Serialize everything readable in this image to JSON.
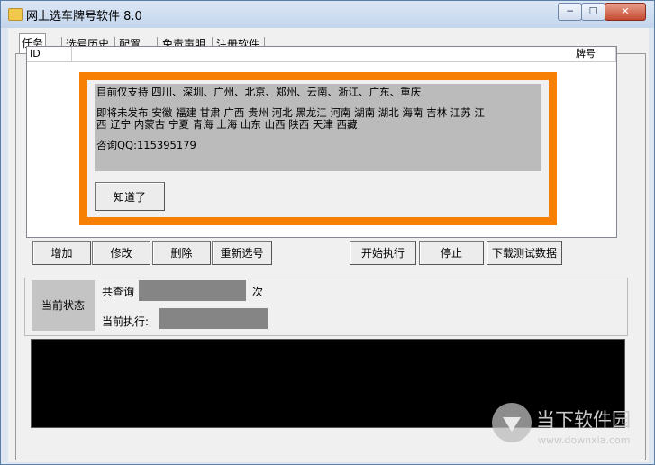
{
  "window": {
    "title": "网上选车牌号软件 8.0",
    "controls": {
      "minimize": "─",
      "maximize": "☐",
      "close": "✕"
    }
  },
  "tabs": [
    "任务",
    "选号历史",
    "配置",
    "免责声明",
    "注册软件"
  ],
  "list": {
    "columns": [
      "ID",
      "牌号"
    ]
  },
  "dialog": {
    "supported": "目前仅支持   四川、深圳、广州、北京、郑州、云南、浙江、广东、重庆",
    "upcoming_line1": "即将未发布:安徽  福建  甘肃 广西 贵州 河北 黑龙江  河南  湖南  湖北 海南 吉林  江苏  江",
    "upcoming_line2": "西 辽宁 内蒙古 宁夏 青海 上海 山东 山西 陕西 天津 西藏",
    "contact": "咨询QQ:115395179",
    "ok_label": "知道了"
  },
  "toolbar": {
    "add": "增加",
    "edit": "修改",
    "delete": "删除",
    "reselect": "重新选号",
    "start": "开始执行",
    "stop": "停止",
    "download": "下载测试数据"
  },
  "status": {
    "label": "当前状态",
    "query_prefix": "共查询",
    "query_suffix": "次",
    "current_exec": "当前执行:"
  },
  "watermark": {
    "text": "当下软件园",
    "url": "www.downxia.com"
  }
}
